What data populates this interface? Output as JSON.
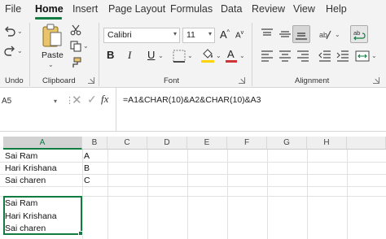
{
  "menu": {
    "tabs": [
      {
        "label": "File"
      },
      {
        "label": "Home"
      },
      {
        "label": "Insert"
      },
      {
        "label": "Page Layout"
      },
      {
        "label": "Formulas"
      },
      {
        "label": "Data"
      },
      {
        "label": "Review"
      },
      {
        "label": "View"
      },
      {
        "label": "Help"
      }
    ],
    "active": "Home"
  },
  "ribbon": {
    "undo_label": "Undo",
    "clipboard": {
      "label": "Clipboard",
      "paste_label": "Paste"
    },
    "font": {
      "label": "Font",
      "font_name": "Calibri",
      "font_size": "11",
      "bold": "B",
      "italic": "I",
      "underline": "U",
      "underline_color": "#ffd400",
      "font_color": "#d13438",
      "font_color_letter": "A",
      "grow": "A",
      "shrink": "A"
    },
    "alignment": {
      "label": "Alignment"
    }
  },
  "formula_bar": {
    "name_box": "A5",
    "fx": "fx",
    "formula": "=A1&CHAR(10)&A2&CHAR(10)&A3"
  },
  "sheet": {
    "columns": [
      "A",
      "B",
      "C",
      "D",
      "E",
      "F",
      "G",
      "H"
    ],
    "selected_column": "A",
    "rows": [
      {
        "a": "Sai Ram",
        "b": "A"
      },
      {
        "a": "Hari Krishana",
        "b": "B"
      },
      {
        "a": "Sai charen",
        "b": "C"
      }
    ],
    "result_lines": [
      "Sai Ram",
      "Hari Krishana",
      "Sai charen"
    ]
  },
  "colors": {
    "accent": "#107c41"
  }
}
